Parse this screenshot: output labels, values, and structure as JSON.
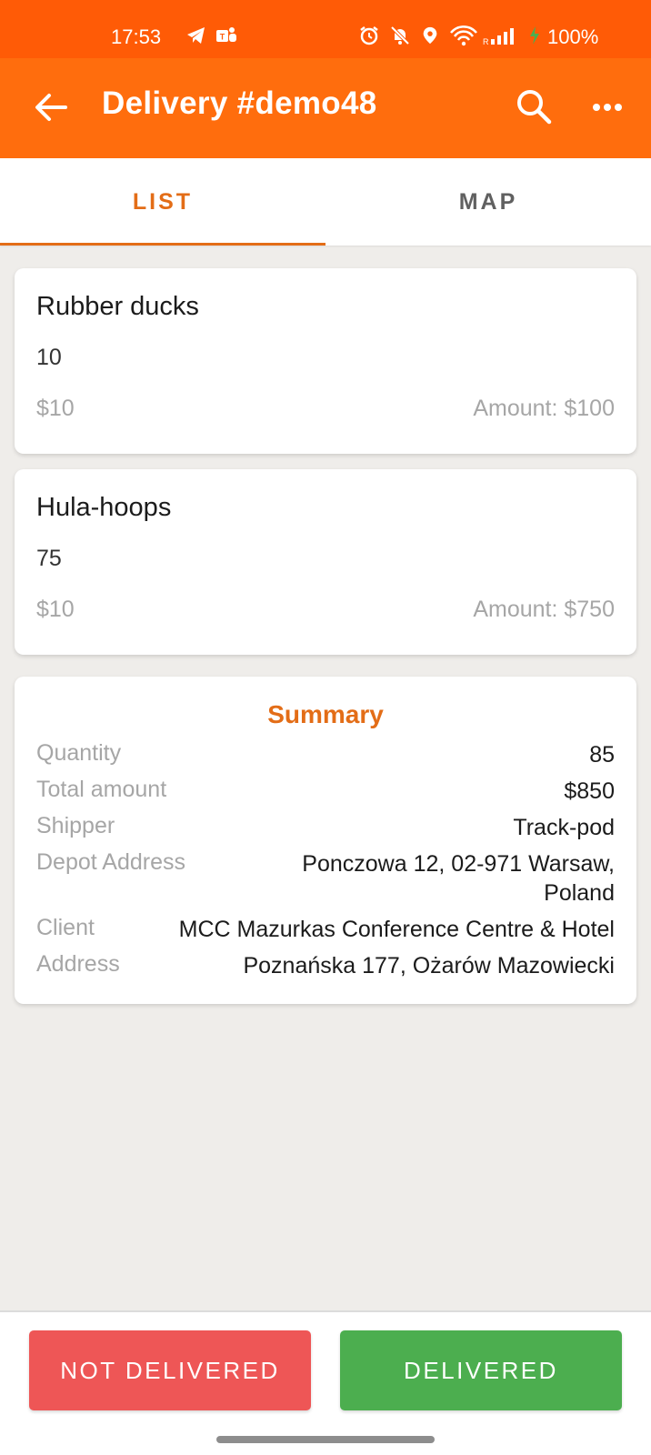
{
  "status_bar": {
    "time": "17:53",
    "battery": "100%",
    "icons": [
      "telegram-icon",
      "teams-icon",
      "alarm-icon",
      "mute-icon",
      "location-icon",
      "wifi-icon",
      "signal-icon",
      "battery-icon"
    ]
  },
  "app_bar": {
    "title": "Delivery #demo48",
    "icons": [
      "back-arrow-icon",
      "search-icon",
      "more-icon"
    ],
    "color": "#ff6d0d"
  },
  "tabs": [
    {
      "label": "LIST",
      "active": true
    },
    {
      "label": "MAP",
      "active": false
    }
  ],
  "items": [
    {
      "name": "Rubber ducks",
      "quantity": "10",
      "price": "$10",
      "amount": "Amount: $100"
    },
    {
      "name": "Hula-hoops",
      "quantity": "75",
      "price": "$10",
      "amount": "Amount: $750"
    }
  ],
  "summary": {
    "title": "Summary",
    "rows": [
      {
        "label": "Quantity",
        "value": "85"
      },
      {
        "label": "Total amount",
        "value": "$850"
      },
      {
        "label": "Shipper",
        "value": "Track-pod"
      },
      {
        "label": "Depot Address",
        "value": "Ponczowa 12, 02-971 Warsaw, Poland"
      },
      {
        "label": "Client",
        "value": "MCC Mazurkas Conference Centre & Hotel"
      },
      {
        "label": "Address",
        "value": "Poznańska 177, Ożarów Mazowiecki"
      }
    ]
  },
  "actions": {
    "not_delivered": "NOT DELIVERED",
    "delivered": "DELIVERED",
    "not_delivered_color": "#ee5656",
    "delivered_color": "#4cae4f"
  }
}
